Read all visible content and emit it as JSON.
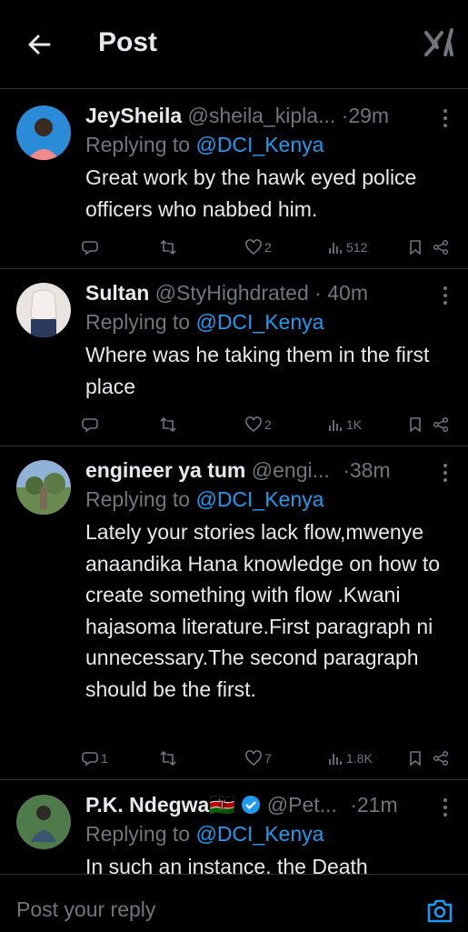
{
  "header": {
    "title": "Post"
  },
  "tweets": [
    {
      "name": "JeySheila",
      "handle": "@sheila_kipla...",
      "dot": "·",
      "time": "29m",
      "replying_prefix": "Replying to ",
      "replying_to": "@DCI_Kenya",
      "text": "Great work by the hawk eyed police officers who nabbed him.",
      "replies": "",
      "reposts": "",
      "likes": "2",
      "views": "512",
      "avatar_color": "#2a8bd6"
    },
    {
      "name": "Sultan",
      "handle": "@StyHighdrated",
      "dot": "·",
      "time": "40m",
      "replying_prefix": "Replying to ",
      "replying_to": "@DCI_Kenya",
      "text": "Where was he taking them in the first place",
      "replies": "",
      "reposts": "",
      "likes": "2",
      "views": "1K",
      "avatar_color": "#d9d4d0"
    },
    {
      "name": "engineer ya tum",
      "handle": "@engi...",
      "dot": "·",
      "time": "38m",
      "replying_prefix": "Replying to ",
      "replying_to": "@DCI_Kenya",
      "text": "Lately your stories lack flow,mwenye anaandika Hana knowledge on how to create something with flow .Kwani hajasoma literature.First paragraph ni unnecessary.The second paragraph should be the first.",
      "replies": "1",
      "reposts": "",
      "likes": "7",
      "views": "1.8K",
      "avatar_color": "#5f7f55"
    },
    {
      "name": "P.K. Ndegwa🇰🇪",
      "handle": "@Pet...",
      "dot": "·",
      "time": "21m",
      "replying_prefix": "Replying to ",
      "replying_to": "@DCI_Kenya",
      "text": "In such an instance, the Death",
      "avatar_color": "#4f7a4a"
    }
  ],
  "reply_bar": {
    "placeholder": "Post your reply"
  },
  "colors": {
    "accent": "#1d9bf0",
    "muted": "#71767b",
    "text": "#e7e9ea",
    "background": "#000000"
  }
}
